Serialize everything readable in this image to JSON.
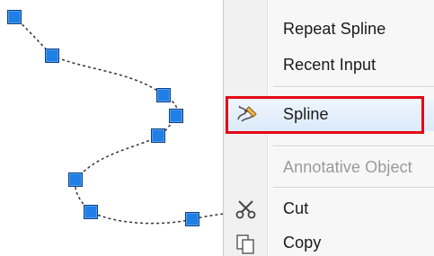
{
  "context_menu": {
    "items": [
      {
        "label": "Repeat Spline",
        "icon": "",
        "enabled": true
      },
      {
        "label": "Recent Input",
        "icon": "",
        "enabled": true
      },
      {
        "label": "Spline",
        "icon": "spline-pen-icon",
        "enabled": true,
        "highlighted": true
      },
      {
        "label": "Annotative Object",
        "icon": "",
        "enabled": false
      },
      {
        "label": "Cut",
        "icon": "scissors-icon",
        "enabled": true
      },
      {
        "label": "Copy",
        "icon": "copy-icon",
        "enabled": true
      }
    ]
  },
  "colors": {
    "grip_fill": "#1f7fe6",
    "grip_border": "#0b3f86",
    "highlight_frame": "#e30613",
    "menu_background": "#f7f7f7",
    "disabled_text": "#9a9a9a"
  }
}
